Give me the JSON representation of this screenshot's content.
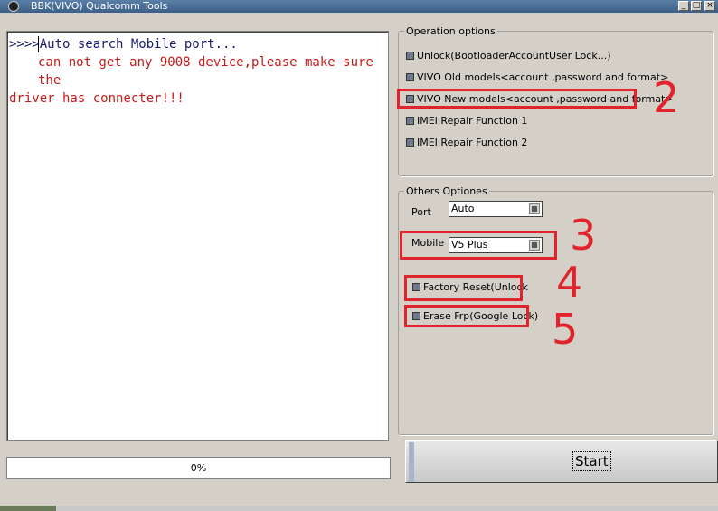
{
  "window": {
    "title": "BBK(VIVO) Qualcomm Tools"
  },
  "console": {
    "line1": ">>>>Auto search Mobile port...",
    "line2": "can not get any 9008 device,please make sure the",
    "line3": "driver has connecter!!!"
  },
  "progress": {
    "text": "0%",
    "value": 0
  },
  "operation_options": {
    "legend": "Operation options",
    "items": [
      {
        "label": "Unlock(BootloaderAccountUser Lock...)"
      },
      {
        "label": "VIVO Old models<account ,password and format>"
      },
      {
        "label": "VIVO New models<account ,password and format>"
      },
      {
        "label": "IMEI Repair Function 1"
      },
      {
        "label": "IMEI Repair Function 2"
      }
    ]
  },
  "others_options": {
    "legend": "Others Optiones",
    "port_label": "Port",
    "port_value": "Auto",
    "mobile_label": "Mobile",
    "mobile_value": "V5 Plus",
    "factory_reset_label": "Factory Reset(Unlock",
    "erase_frp_label": "Erase Frp(Google Lock)"
  },
  "annotations": [
    "2",
    "3",
    "4",
    "5"
  ],
  "start_button": {
    "label": "Start"
  },
  "colors": {
    "annotation_red": "#e1232b",
    "console_blue": "#1a1a70",
    "console_red": "#c81818"
  }
}
